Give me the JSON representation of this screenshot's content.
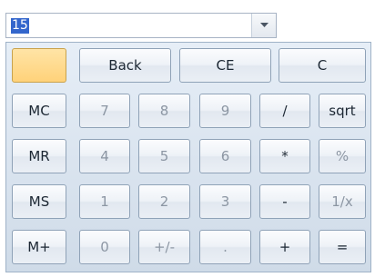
{
  "display": {
    "value": "15"
  },
  "icons": {
    "dropdown": "chevron-down-icon"
  },
  "colors": {
    "selection": "#3366cc",
    "memory_indicator": "#ffd27a",
    "digit_text": "#8c96a3",
    "operator_text": "#1c2733"
  },
  "keys": {
    "back": "Back",
    "ce": "CE",
    "c": "C",
    "mc": "MC",
    "mr": "MR",
    "ms": "MS",
    "mplus": "M+",
    "n7": "7",
    "n8": "8",
    "n9": "9",
    "n4": "4",
    "n5": "5",
    "n6": "6",
    "n1": "1",
    "n2": "2",
    "n3": "3",
    "n0": "0",
    "sign": "+/-",
    "dot": ".",
    "div": "/",
    "mul": "*",
    "sub": "-",
    "add": "+",
    "sqrt": "sqrt",
    "pct": "%",
    "inv": "1/x",
    "eq": "="
  }
}
